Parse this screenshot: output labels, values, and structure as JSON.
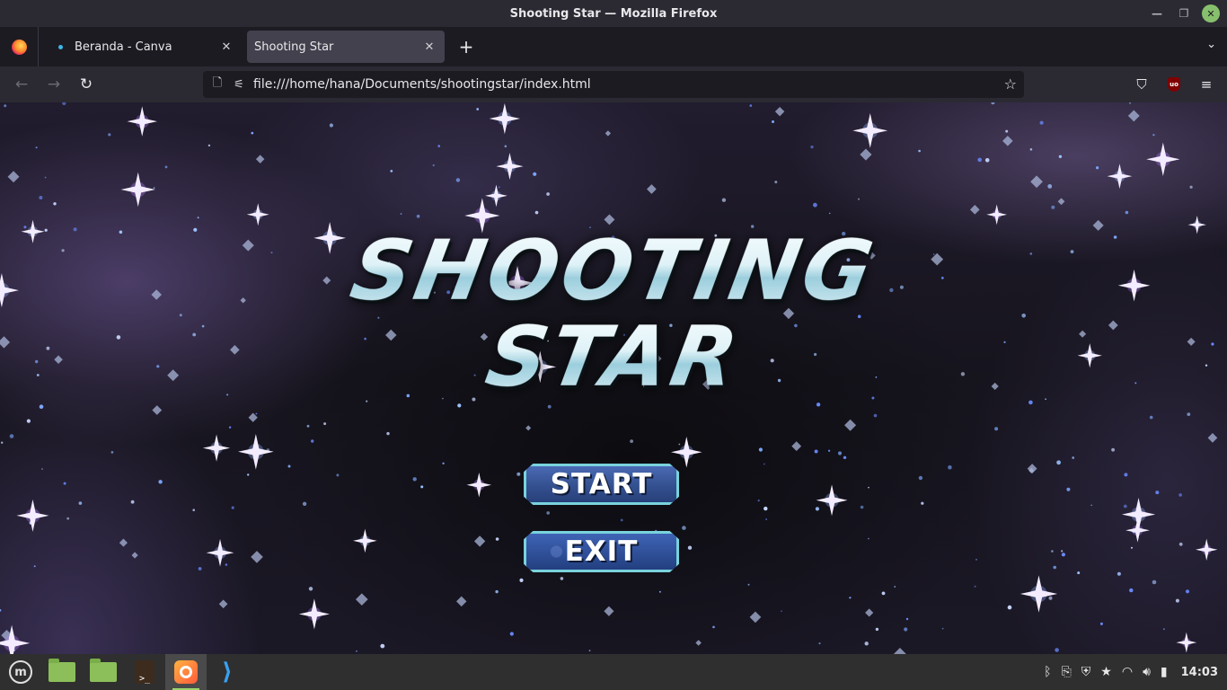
{
  "window": {
    "title": "Shooting Star — Mozilla Firefox"
  },
  "tabs": [
    {
      "label": "Beranda - Canva",
      "active": false
    },
    {
      "label": "Shooting Star",
      "active": true
    }
  ],
  "urlbar": {
    "url": "file:///home/hana/Documents/shootingstar/index.html"
  },
  "game": {
    "title_line1": "SHOOTING",
    "title_line2": "STAR",
    "start_label": "START",
    "exit_label": "EXIT",
    "accent_color": "#79d2dc",
    "button_color": "#34508f"
  },
  "taskbar": {
    "apps": [
      "menu-icon",
      "files-icon",
      "folder-icon",
      "terminal-icon",
      "firefox-icon",
      "vscode-icon"
    ],
    "clock": "14:03"
  },
  "icons": {
    "back": "←",
    "forward": "→",
    "reload": "↻",
    "star": "☆",
    "menu": "≡",
    "close_tab": "✕",
    "new_tab": "+",
    "tab_list": "⌄"
  }
}
